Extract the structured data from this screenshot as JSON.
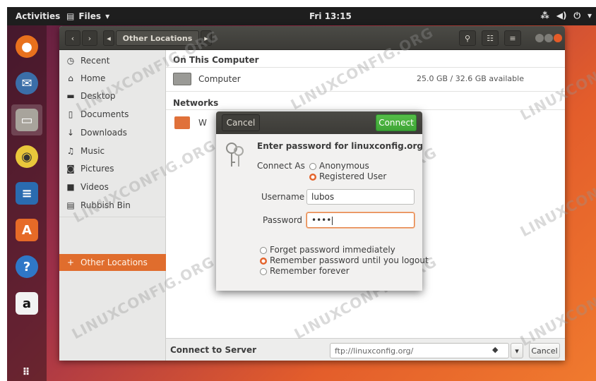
{
  "topbar": {
    "activities": "Activities",
    "app_menu": "Files",
    "clock": "Fri 13:15"
  },
  "dock": {
    "items": [
      {
        "name": "firefox",
        "color": "#e8711d"
      },
      {
        "name": "thunderbird",
        "color": "#3b6ea8"
      },
      {
        "name": "files",
        "color": "#a8a49c"
      },
      {
        "name": "rhythmbox",
        "color": "#e9c73b"
      },
      {
        "name": "libreoffice-writer",
        "color": "#2a6bb0"
      },
      {
        "name": "ubuntu-software",
        "color": "#e66a27"
      },
      {
        "name": "help",
        "color": "#2f77c7"
      },
      {
        "name": "amazon",
        "color": "#f2f2f2"
      }
    ]
  },
  "headerbar": {
    "path_current": "Other Locations"
  },
  "sidebar": {
    "items": [
      {
        "label": "Recent",
        "icon": "clock-icon",
        "glyph": "◷"
      },
      {
        "label": "Home",
        "icon": "home-icon",
        "glyph": "⌂"
      },
      {
        "label": "Desktop",
        "icon": "desktop-icon",
        "glyph": "▬"
      },
      {
        "label": "Documents",
        "icon": "document-icon",
        "glyph": "▯"
      },
      {
        "label": "Downloads",
        "icon": "download-icon",
        "glyph": "↓"
      },
      {
        "label": "Music",
        "icon": "music-icon",
        "glyph": "♫"
      },
      {
        "label": "Pictures",
        "icon": "camera-icon",
        "glyph": "◙"
      },
      {
        "label": "Videos",
        "icon": "video-icon",
        "glyph": "■"
      },
      {
        "label": "Rubbish Bin",
        "icon": "trash-icon",
        "glyph": "▤"
      }
    ],
    "other_locations": {
      "label": "Other Locations",
      "glyph": "+"
    }
  },
  "main": {
    "on_this_computer": "On This Computer",
    "computer_label": "Computer",
    "computer_size": "25.0 GB / 32.6 GB available",
    "networks": "Networks",
    "network_item_partial": "W"
  },
  "bottombar": {
    "label": "Connect to Server",
    "server_value": "ftp://linuxconfig.org/",
    "cancel": "Cancel"
  },
  "dialog": {
    "cancel": "Cancel",
    "connect": "Connect",
    "title": "Enter password for linuxconfig.org",
    "connect_as": "Connect As",
    "anonymous": "Anonymous",
    "registered_user": "Registered User",
    "username_label": "Username",
    "username_value": "lubos",
    "password_label": "Password",
    "password_value": "••••",
    "forget": "Forget password immediately",
    "remember_logout": "Remember password until you logout",
    "remember_forever": "Remember forever"
  },
  "colors": {
    "accent": "#e95420",
    "selected": "#e06d2d",
    "connect_green": "#3ea536"
  },
  "watermark": "LINUXCONFIG.ORG"
}
